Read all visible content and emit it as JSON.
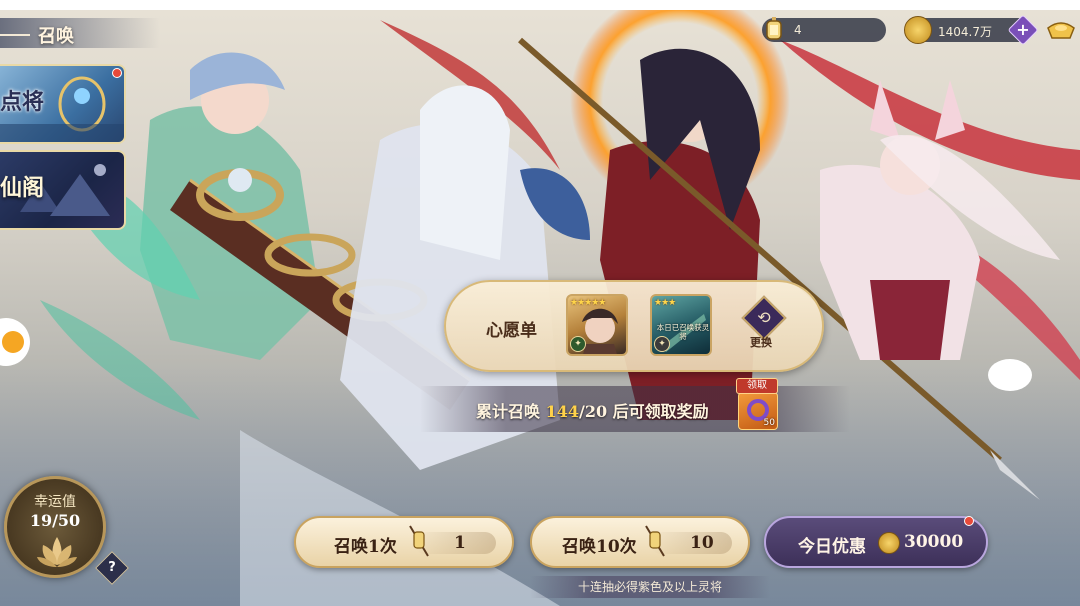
{
  "header": {
    "title": "召唤"
  },
  "banners": [
    {
      "label": "点将"
    },
    {
      "label": "仙阁"
    }
  ],
  "resources": {
    "summon_tickets": "4",
    "gold": "1404.7万"
  },
  "wishlist": {
    "label": "心愿单",
    "card1_stars": "★★★★★",
    "card2_stars": "★★★",
    "card2_text": "本日已召唤获灵将",
    "swap_label": "更换"
  },
  "progress": {
    "prefix": "累计召唤 ",
    "current": "144",
    "suffix": "/20 后可领取奖励",
    "reward_tag": "领取",
    "reward_qty": "50"
  },
  "lucky": {
    "label": "幸运值",
    "value": "19/50",
    "help": "?"
  },
  "summon": {
    "single_label": "召唤1次",
    "single_cost": "1",
    "ten_label": "召唤10次",
    "ten_cost": "10",
    "deal_label": "今日优惠",
    "deal_cost": "30000"
  },
  "footer_note": "十连抽必得紫色及以上灵将",
  "colors": {
    "accent_gold": "#c9a35f",
    "deal_purple": "#4a3c6a",
    "highlight_yellow": "#ffd24a",
    "notify_red": "#e84a3a"
  }
}
